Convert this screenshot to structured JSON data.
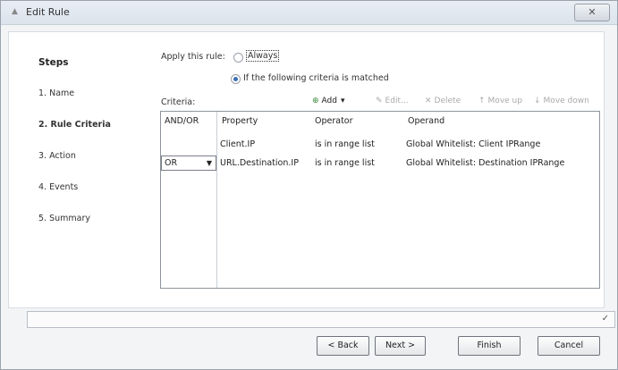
{
  "window": {
    "title": "Edit Rule",
    "close_glyph": "✕"
  },
  "steps": {
    "heading": "Steps",
    "items": [
      "1. Name",
      "2. Rule Criteria",
      "3. Action",
      "4. Events",
      "5. Summary"
    ],
    "active_index": 1
  },
  "apply": {
    "label": "Apply this rule:",
    "option_always": "Always",
    "option_criteria": "If the following criteria is matched",
    "selected": "criteria"
  },
  "criteria": {
    "label": "Criteria:",
    "toolbar": {
      "add": "Add",
      "edit": "Edit...",
      "delete": "Delete",
      "move_up": "Move up",
      "move_down": "Move down"
    },
    "columns": [
      "AND/OR",
      "Property",
      "Operator",
      "Operand"
    ],
    "rows": [
      {
        "andor": "",
        "property": "Client.IP",
        "operator": "is in range list",
        "operand": "Global Whitelist: Client IPRange"
      },
      {
        "andor": "OR",
        "property": "URL.Destination.IP",
        "operator": "is in range list",
        "operand": "Global Whitelist: Destination IPRange"
      }
    ]
  },
  "footer": {
    "back": "< Back",
    "next": "Next >",
    "finish": "Finish",
    "cancel": "Cancel"
  }
}
